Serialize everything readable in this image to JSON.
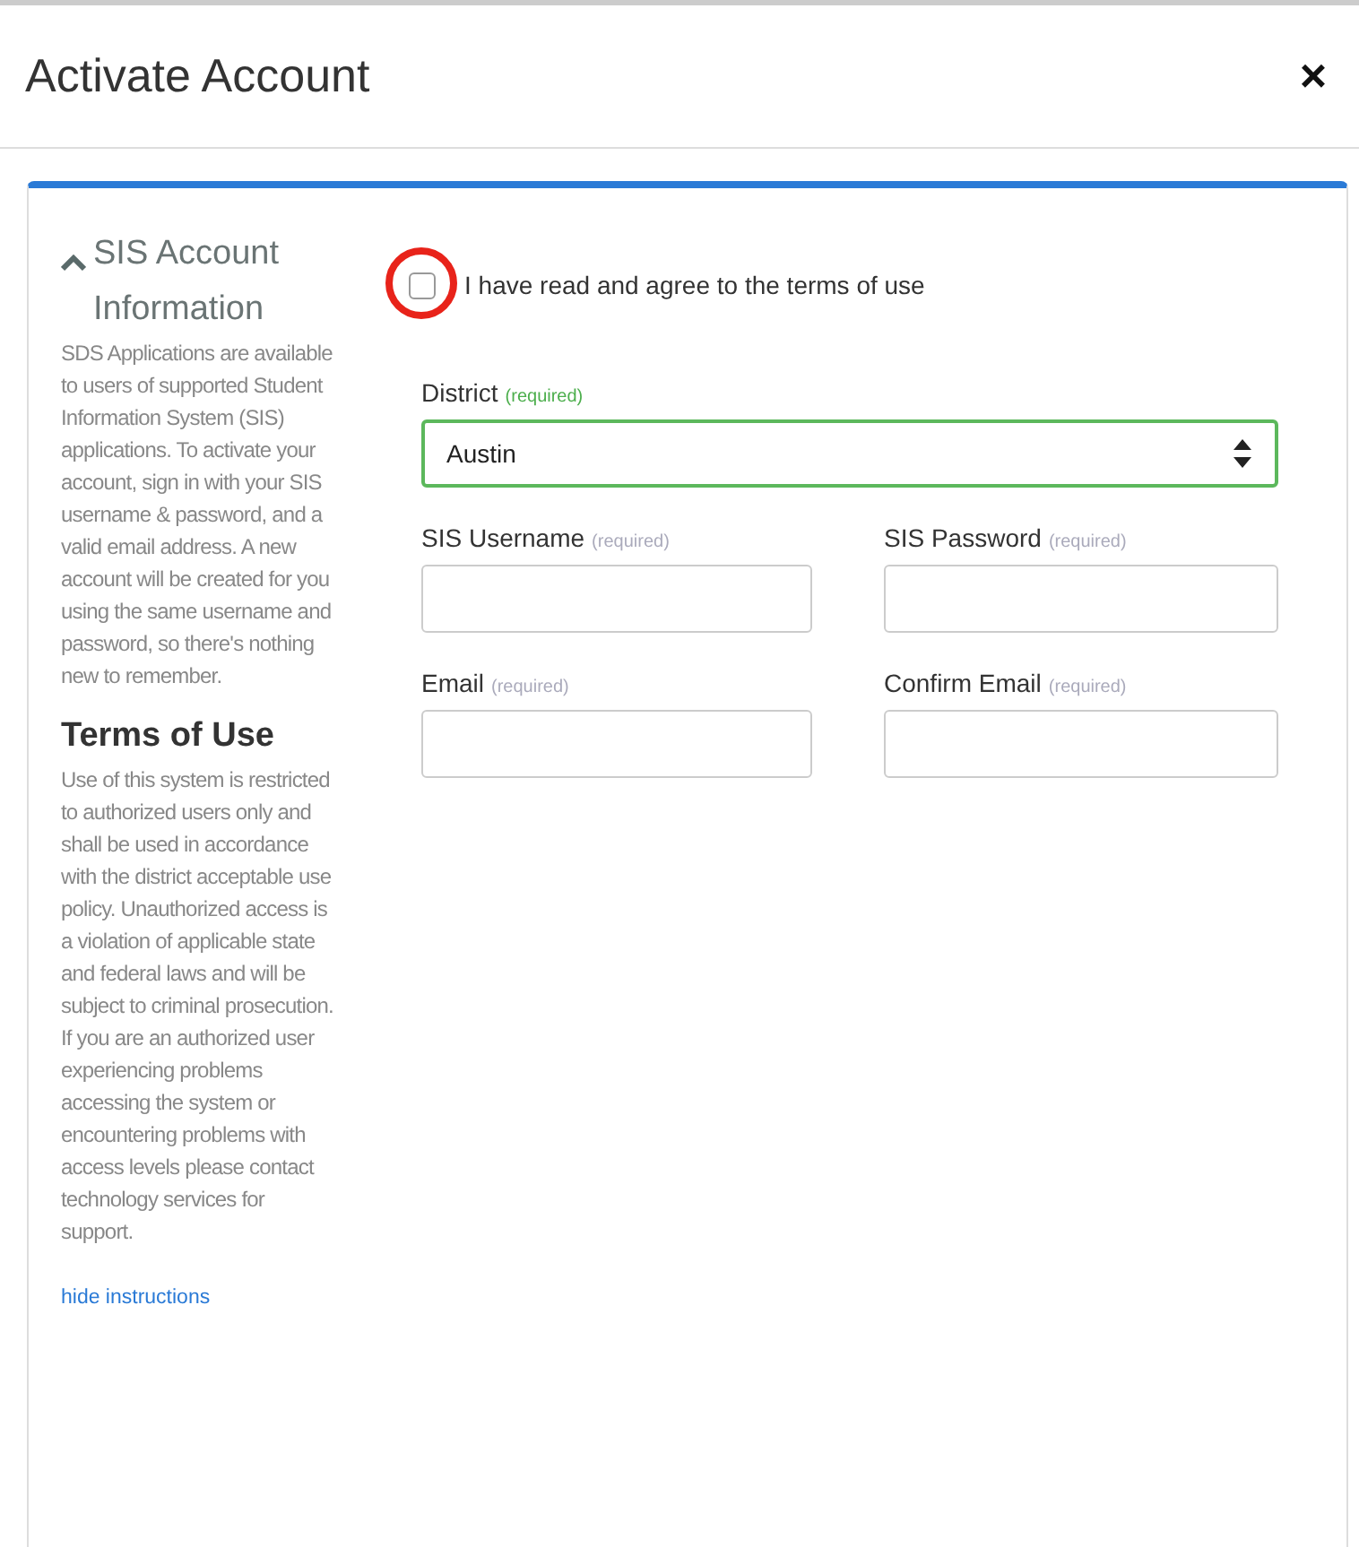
{
  "dialog": {
    "title": "Activate Account",
    "close": "×"
  },
  "sidebar": {
    "expanded": true,
    "heading": "SIS Account Information",
    "intro": "SDS Applications are available to users of supported Student Information System (SIS) applications. To activate your account, sign in with your SIS username & password, and a valid email address. A new account will be created for you using the same username and password, so there's nothing new to remember.",
    "terms_heading": "Terms of Use",
    "terms": "Use of this system is restricted to authorized users only and shall be used in accordance with the district acceptable use policy. Unauthorized access is a violation of applicable state and federal laws and will be subject to criminal prosecution. If you are an authorized user experiencing problems accessing the system or encountering problems with access levels please contact technology services for support.",
    "toggle_link": "hide instructions"
  },
  "agree": {
    "label": "I have read and agree to the terms of use",
    "checked": false,
    "highlighted": true
  },
  "fields": [
    {
      "kind": "select",
      "label": "District",
      "hint": "(required)",
      "value": "Austin",
      "valid": true
    },
    {
      "kind": "text",
      "label": "SIS Username",
      "hint": "(required)",
      "valid": false
    },
    {
      "kind": "text",
      "label": "SIS Password",
      "hint": "(required)",
      "valid": false
    },
    {
      "kind": "text",
      "label": "Email",
      "hint": "(required)",
      "valid": false
    },
    {
      "kind": "text",
      "label": "Confirm Email",
      "hint": "(required)",
      "valid": false
    }
  ]
}
